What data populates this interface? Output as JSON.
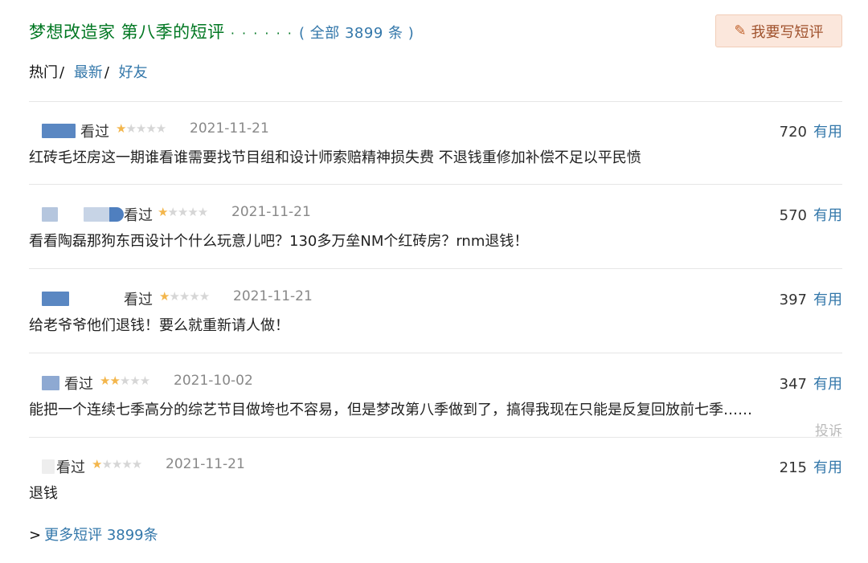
{
  "header": {
    "title": "梦想改造家 第八季的短评",
    "dots": "· · · · · ·",
    "all_label": "( 全部 3899 条 )",
    "write_button": "我要写短评"
  },
  "tabs": {
    "hot": "热门",
    "latest": "最新",
    "friends": "好友",
    "sep": "/"
  },
  "comments": [
    {
      "status": "看过",
      "rating": 1,
      "date": "2021-11-21",
      "votes": "720",
      "useful": "有用",
      "text": "红砖毛坯房这一期谁看谁需要找节目组和设计师索赔精神损失费 不退钱重修加补偿不足以平民愤"
    },
    {
      "status": "看过",
      "rating": 1,
      "date": "2021-11-21",
      "votes": "570",
      "useful": "有用",
      "text": "看看陶磊那狗东西设计个什么玩意儿吧？130多万垒NM个红砖房？rnm退钱！"
    },
    {
      "status": "看过",
      "rating": 1,
      "date": "2021-11-21",
      "votes": "397",
      "useful": "有用",
      "text": "给老爷爷他们退钱！要么就重新请人做！"
    },
    {
      "status": "看过",
      "rating": 2,
      "date": "2021-10-02",
      "votes": "347",
      "useful": "有用",
      "text": "能把一个连续七季高分的综艺节目做垮也不容易，但是梦改第八季做到了，搞得我现在只能是反复回放前七季……",
      "report": "投诉"
    },
    {
      "status": "看过",
      "rating": 1,
      "date": "2021-11-21",
      "votes": "215",
      "useful": "有用",
      "text": "退钱"
    }
  ],
  "more": {
    "arrow": ">",
    "label": "更多短评 3899条"
  },
  "colors": {
    "title_green": "#007722",
    "link_blue": "#3377aa",
    "star_gold": "#f3b64c",
    "button_bg": "#fbe7dc"
  }
}
